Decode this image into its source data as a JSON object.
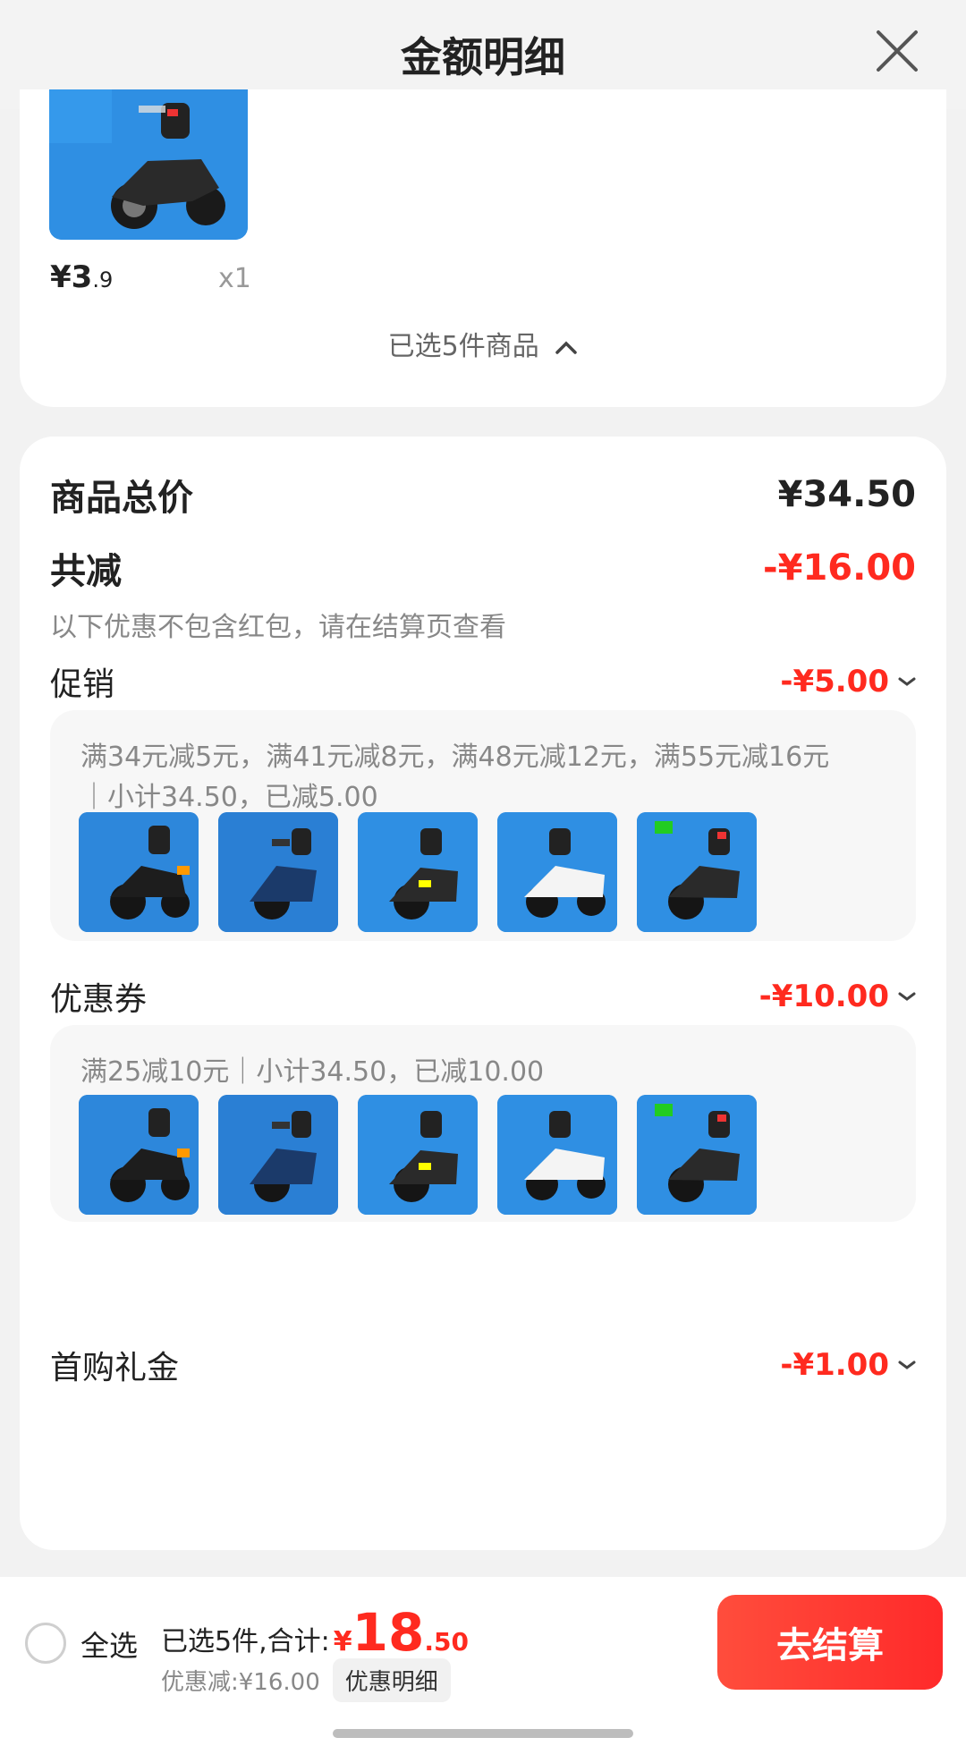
{
  "header": {
    "title": "金额明细"
  },
  "top_item": {
    "price_main": "¥3",
    "price_decimal": ".9",
    "qty": "x1"
  },
  "selected_toggle": {
    "label": "已选5件商品"
  },
  "summary": {
    "total_label": "商品总价",
    "total_value": "¥34.50",
    "reduce_label": "共减",
    "reduce_value": "-¥16.00",
    "reduce_note": "以下优惠不包含红包，请在结算页查看"
  },
  "promotion": {
    "label": "促销",
    "value": "-¥5.00",
    "line1": "满34元减5元，满41元减8元，满48元减12元，满55元减16元",
    "line2": "｜小计34.50，已减5.00"
  },
  "coupon": {
    "label": "优惠券",
    "value": "-¥10.00",
    "line1": "满25减10元｜小计34.50，已减10.00"
  },
  "gift": {
    "label": "首购礼金",
    "value": "-¥1.00"
  },
  "bottom_bar": {
    "select_all": "全选",
    "summary_prefix": "已选5件,合计:",
    "yen": "¥",
    "total_int": "18",
    "total_dec": ".50",
    "discount_text": "优惠减:¥16.00",
    "discount_detail_btn": "优惠明细",
    "checkout_label": "去结算"
  },
  "colors": {
    "accent_red": "#ff2a1f",
    "thumb_blue": "#2d87db"
  }
}
